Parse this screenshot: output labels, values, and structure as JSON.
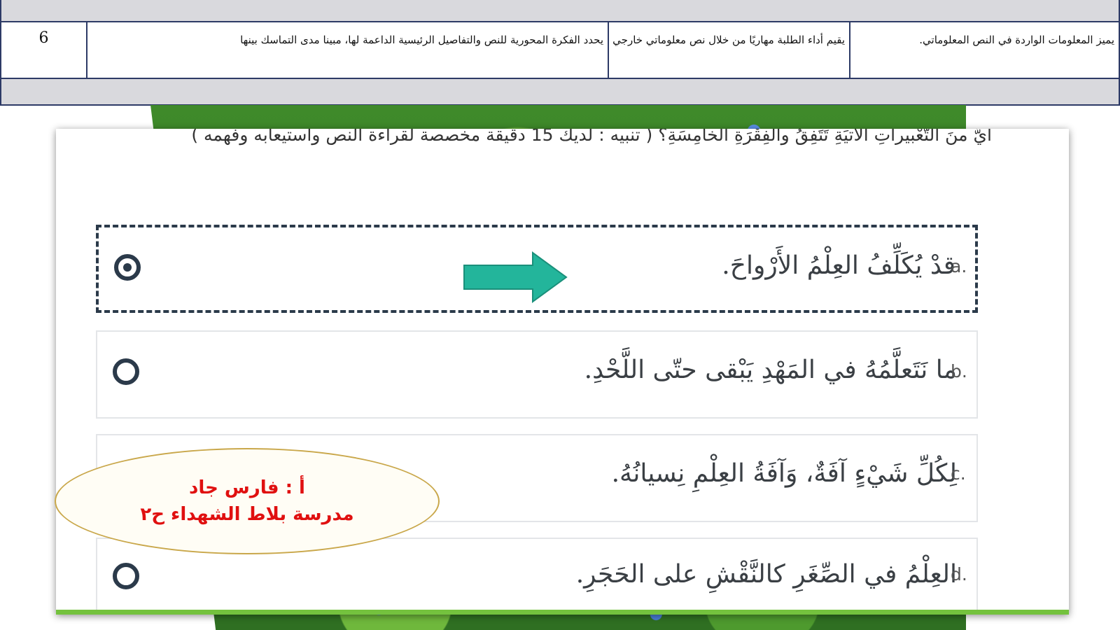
{
  "criteria_table": {
    "cells": [
      "يميز المعلومات الواردة في النص المعلوماتي.",
      "يقيم أداء الطلبة مهاريًا من خلال نص معلوماتي خارجي",
      "يحدد الفكرة المحورية للنص والتفاصيل الرئيسية الداعمة لها، مبينا مدى التماسك بينها",
      "6"
    ]
  },
  "question": {
    "text": "ايٌّ منَ التَّعْبيراتِ الآتيَةِ تَتَفِقُ والفِقْرَةِ الخامِسَةِ؟ ( تنبيه : لديك 15 دقيقة مخصصة لقراءة النص واستيعابه وفهمه )"
  },
  "options": [
    {
      "letter": "a.",
      "text": "قدْ يُكَلِّفُ العِلْمُ الأَرْواحَ.",
      "selected": true
    },
    {
      "letter": "b.",
      "text": "ما نَتَعلَّمُهُ في المَهْدِ يَبْقى حتّى اللَّحْدِ.",
      "selected": false
    },
    {
      "letter": "c.",
      "text": "لِكُلِّ شَيْءٍ آفَةٌ، وَآفَةُ العِلْمِ نِسيانُهُ.",
      "selected": false
    },
    {
      "letter": "d.",
      "text": "العِلْمُ في الصِّغَرِ كالنَّقْشِ على الحَجَرِ.",
      "selected": false
    }
  ],
  "credit": {
    "line1": "أ : فارس جاد",
    "line2": "مدرسة بلاط الشهداء ح٢"
  },
  "colors": {
    "arrow": "#23b59b",
    "credit_text": "#e01010",
    "table_border": "#2d3a66",
    "accent_bar": "#74c23e"
  }
}
